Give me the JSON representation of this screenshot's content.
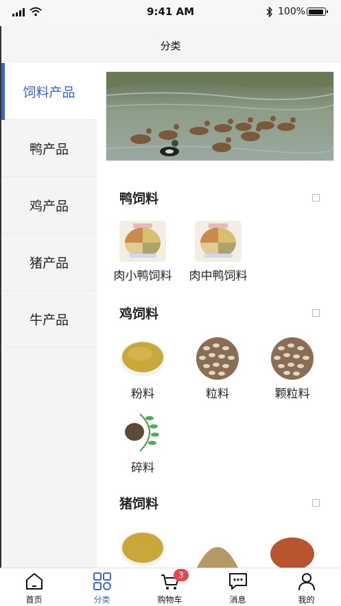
{
  "status_bar": {
    "time": "9:41 AM",
    "battery": "100%"
  },
  "nav": {
    "title": "分类"
  },
  "sidebar": {
    "items": [
      {
        "label": "饲料产品",
        "active": true
      },
      {
        "label": "鸭产品"
      },
      {
        "label": "鸡产品"
      },
      {
        "label": "猪产品"
      },
      {
        "label": "牛产品"
      }
    ]
  },
  "sections": [
    {
      "title": "鸭饲料",
      "items": [
        {
          "label": "肉小鸭饲料"
        },
        {
          "label": "肉中鸭饲料"
        }
      ]
    },
    {
      "title": "鸡饲料",
      "items": [
        {
          "label": "粉料"
        },
        {
          "label": "粒料"
        },
        {
          "label": "颗粒料"
        },
        {
          "label": "碎料"
        }
      ]
    },
    {
      "title": "猪饲料",
      "items": [
        {
          "label": ""
        },
        {
          "label": ""
        },
        {
          "label": ""
        }
      ]
    }
  ],
  "tabbar": {
    "items": [
      {
        "label": "首页",
        "icon": "home-icon"
      },
      {
        "label": "分类",
        "icon": "category-icon",
        "active": true
      },
      {
        "label": "购物车",
        "icon": "cart-icon",
        "badge": "3"
      },
      {
        "label": "消息",
        "icon": "message-icon"
      },
      {
        "label": "我的",
        "icon": "user-icon"
      }
    ]
  },
  "colors": {
    "accent": "#3a66c4",
    "badge": "#e8474a"
  }
}
